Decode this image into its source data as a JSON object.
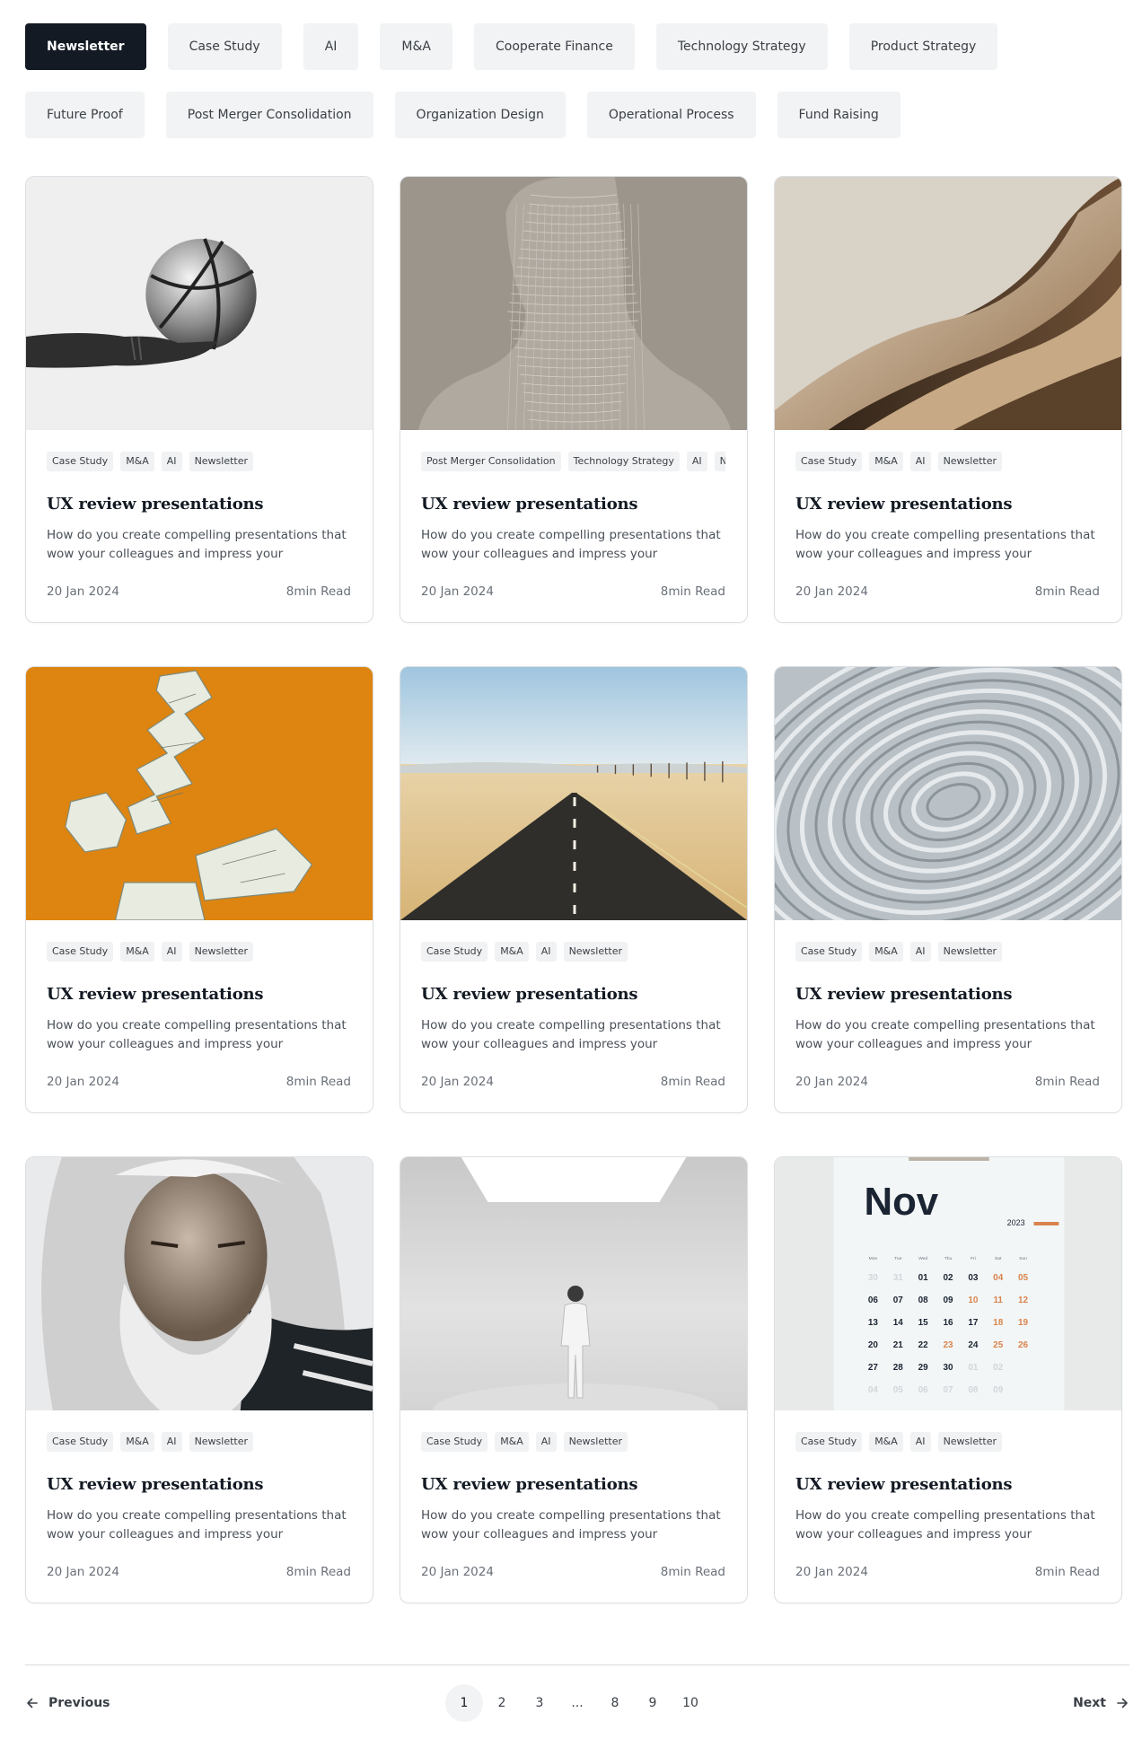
{
  "filters": [
    {
      "label": "Newsletter",
      "active": true
    },
    {
      "label": "Case Study"
    },
    {
      "label": "AI"
    },
    {
      "label": "M&A"
    },
    {
      "label": "Cooperate Finance"
    },
    {
      "label": "Technology Strategy"
    },
    {
      "label": "Product Strategy"
    },
    {
      "label": "Future Proof"
    },
    {
      "label": "Post Merger Consolidation"
    },
    {
      "label": "Organization Design"
    },
    {
      "label": "Operational Process"
    },
    {
      "label": "Fund Raising"
    }
  ],
  "cards": [
    {
      "image": "basketball-hand",
      "tags": [
        "Case Study",
        "M&A",
        "AI",
        "Newsletter"
      ],
      "title": "UX review presentations",
      "excerpt": "How do you create compelling presentations that wow your colleagues and impress your managers?",
      "date": "20 Jan 2024",
      "read": "8min Read"
    },
    {
      "image": "wireframe-face",
      "tags": [
        "Post Merger Consolidation",
        "Technology Strategy",
        "AI",
        "Newsletter"
      ],
      "title": "UX review presentations",
      "excerpt": "How do you create compelling presentations that wow your colleagues and impress your managers?",
      "date": "20 Jan 2024",
      "read": "8min Read"
    },
    {
      "image": "abstract-waves",
      "tags": [
        "Case Study",
        "M&A",
        "AI",
        "Newsletter"
      ],
      "title": "UX review presentations",
      "excerpt": "How do you create compelling presentations that wow your colleagues and impress your managers?",
      "date": "20 Jan 2024",
      "read": "8min Read"
    },
    {
      "image": "crumpled-dollars",
      "tags": [
        "Case Study",
        "M&A",
        "AI",
        "Newsletter"
      ],
      "title": "UX review presentations",
      "excerpt": "How do you create compelling presentations that wow your colleagues and impress your managers?",
      "date": "20 Jan 2024",
      "read": "8min Read"
    },
    {
      "image": "desert-road",
      "tags": [
        "Case Study",
        "M&A",
        "AI",
        "Newsletter"
      ],
      "title": "UX review presentations",
      "excerpt": "How do you create compelling presentations that wow your colleagues and impress your managers?",
      "date": "20 Jan 2024",
      "read": "8min Read"
    },
    {
      "image": "paper-spiral",
      "tags": [
        "Case Study",
        "M&A",
        "AI",
        "Newsletter"
      ],
      "title": "UX review presentations",
      "excerpt": "How do you create compelling presentations that wow your colleagues and impress your managers?",
      "date": "20 Jan 2024",
      "read": "8min Read"
    },
    {
      "image": "old-man-portrait",
      "tags": [
        "Case Study",
        "M&A",
        "AI",
        "Newsletter"
      ],
      "title": "UX review presentations",
      "excerpt": "How do you create compelling presentations that wow your colleagues and impress your managers?",
      "date": "20 Jan 2024",
      "read": "8min Read"
    },
    {
      "image": "white-room-figure",
      "tags": [
        "Case Study",
        "M&A",
        "AI",
        "Newsletter"
      ],
      "title": "UX review presentations",
      "excerpt": "How do you create compelling presentations that wow your colleagues and impress your managers?",
      "date": "20 Jan 2024",
      "read": "8min Read"
    },
    {
      "image": "calendar-november",
      "tags": [
        "Case Study",
        "M&A",
        "AI",
        "Newsletter"
      ],
      "title": "UX review presentations",
      "excerpt": "How do you create compelling presentations that wow your colleagues and impress your managers?",
      "date": "20 Jan 2024",
      "read": "8min Read"
    }
  ],
  "calendar": {
    "month": "Nov",
    "year": "2023",
    "weekdays": [
      "Mon",
      "Tue",
      "Wed",
      "Thu",
      "Fri",
      "Sat",
      "Sun"
    ],
    "rows": [
      [
        "30",
        "31",
        "01",
        "02",
        "03",
        "04",
        "05"
      ],
      [
        "06",
        "07",
        "08",
        "09",
        "10",
        "11",
        "12"
      ],
      [
        "13",
        "14",
        "15",
        "16",
        "17",
        "18",
        "19"
      ],
      [
        "20",
        "21",
        "22",
        "23",
        "24",
        "25",
        "26"
      ],
      [
        "27",
        "28",
        "29",
        "30",
        "01",
        "02",
        ""
      ],
      [
        "04",
        "05",
        "06",
        "07",
        "08",
        "09",
        ""
      ]
    ],
    "accent": "#d9834d"
  },
  "pagination": {
    "prev_label": "Previous",
    "next_label": "Next",
    "pages": [
      "1",
      "2",
      "3",
      "...",
      "8",
      "9",
      "10"
    ],
    "current": "1"
  },
  "colors": {
    "active_chip": "#131a23",
    "chip_bg": "#f2f3f4",
    "card_border": "#dcdfe3"
  }
}
